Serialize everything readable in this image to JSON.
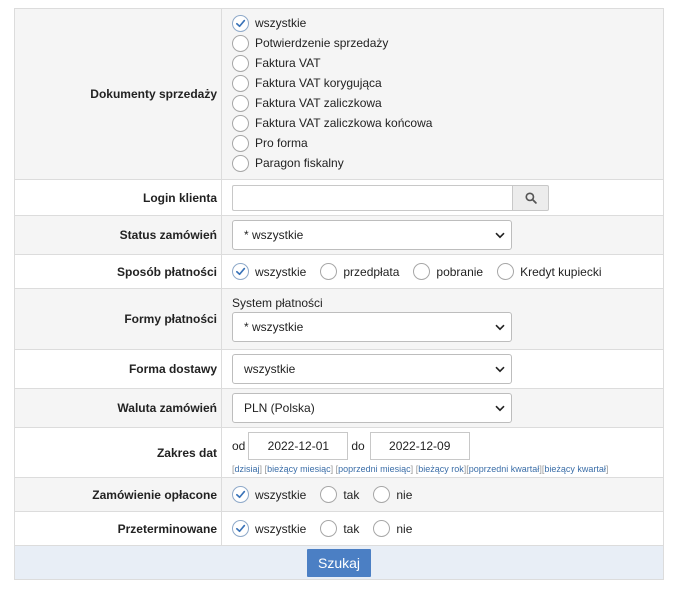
{
  "sales_documents": {
    "label": "Dokumenty sprzedaży",
    "options": [
      "wszystkie",
      "Potwierdzenie sprzedaży",
      "Faktura VAT",
      "Faktura VAT korygująca",
      "Faktura VAT zaliczkowa",
      "Faktura VAT zaliczkowa końcowa",
      "Pro forma",
      "Paragon fiskalny"
    ],
    "selected": "wszystkie"
  },
  "login": {
    "label": "Login klienta",
    "value": "",
    "search_icon": "search-icon"
  },
  "order_status": {
    "label": "Status zamówień",
    "value": "* wszystkie"
  },
  "payment_method": {
    "label": "Sposób płatności",
    "options": [
      "wszystkie",
      "przedpłata",
      "pobranie",
      "Kredyt kupiecki"
    ],
    "selected": "wszystkie"
  },
  "payment_forms": {
    "label": "Formy płatności",
    "sublabel": "System płatności",
    "value": "* wszystkie"
  },
  "delivery": {
    "label": "Forma dostawy",
    "value": "wszystkie"
  },
  "currency": {
    "label": "Waluta zamówień",
    "value": "PLN (Polska)"
  },
  "date_range": {
    "label": "Zakres dat",
    "from_label": "od",
    "from": "2022-12-01",
    "to_label": "do",
    "to": "2022-12-09",
    "links": [
      "dzisiaj",
      "bieżący miesiąc",
      "poprzedni miesiąc",
      "bieżący rok",
      "poprzedni kwartał",
      "bieżący kwartał"
    ]
  },
  "paid": {
    "label": "Zamówienie opłacone",
    "options": [
      "wszystkie",
      "tak",
      "nie"
    ],
    "selected": "wszystkie"
  },
  "overdue": {
    "label": "Przeterminowane",
    "options": [
      "wszystkie",
      "tak",
      "nie"
    ],
    "selected": "wszystkie"
  },
  "submit_label": "Szukaj",
  "colors": {
    "accent": "#4b7fc4",
    "check": "#3a73b8",
    "footer_bg": "#e8eef6"
  }
}
